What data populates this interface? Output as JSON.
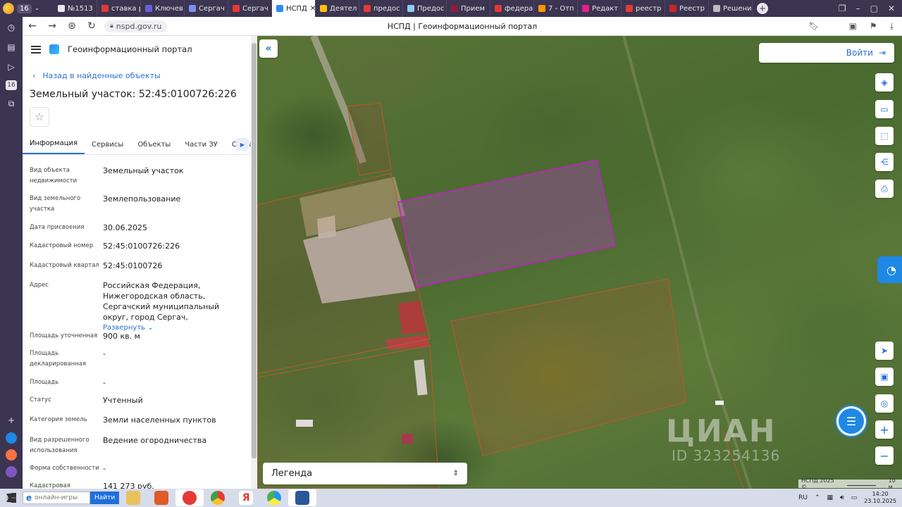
{
  "browser": {
    "tab_count": "16",
    "tabs": [
      {
        "label": "№1513",
        "color": "#e8e6ef"
      },
      {
        "label": "ставка р",
        "color": "#e53935"
      },
      {
        "label": "Ключев",
        "color": "#6d5fd3"
      },
      {
        "label": "Сергач",
        "color": "#7e8ff0"
      },
      {
        "label": "Сергач",
        "color": "#e53935"
      },
      {
        "label": "НСПД",
        "color": "#2c8cf4",
        "active": true
      },
      {
        "label": "Деятел",
        "color": "#ffc107"
      },
      {
        "label": "предос",
        "color": "#e53935"
      },
      {
        "label": "Предос",
        "color": "#90caf9"
      },
      {
        "label": "Прием",
        "color": "#8e1b3c"
      },
      {
        "label": "федера",
        "color": "#e53935"
      },
      {
        "label": "7 - Отп",
        "color": "#ff9800"
      },
      {
        "label": "Редакт",
        "color": "#e91e8c"
      },
      {
        "label": "реестр",
        "color": "#e53935"
      },
      {
        "label": "Реестр",
        "color": "#c62828"
      },
      {
        "label": "Решени",
        "color": "#bbbbbb"
      }
    ],
    "url": "nspd.gov.ru",
    "page_title": "НСПД | Геоинформационный портал"
  },
  "panel": {
    "portal_name": "Геоинформационный портал",
    "back_link": "Назад в найденные объекты",
    "title": "Земельный участок: 52:45:0100726:226",
    "tabs": [
      "Информация",
      "Сервисы",
      "Объекты",
      "Части ЗУ",
      "Состав"
    ],
    "properties": [
      {
        "label": "Вид объекта недвижимости",
        "value": "Земельный участок"
      },
      {
        "label": "Вид земельного участка",
        "value": "Землепользование"
      },
      {
        "label": "Дата присвоения",
        "value": "30.06.2025"
      },
      {
        "label": "Кадастровый номер",
        "value": "52:45:0100726:226"
      },
      {
        "label": "Кадастровый квартал",
        "value": "52:45:0100726"
      },
      {
        "label": "Адрес",
        "value": "Российская Федерация, Нижегородская область, Сергачский муниципальный округ, город Сергач,"
      },
      {
        "label": "Площадь уточненная",
        "value": "900 кв. м"
      },
      {
        "label": "Площадь декларированная",
        "value": "-"
      },
      {
        "label": "Площадь",
        "value": "-"
      },
      {
        "label": "Статус",
        "value": "Учтенный"
      },
      {
        "label": "Категория земель",
        "value": "Земли населенных пунктов"
      },
      {
        "label": "Вид разрешенного использования",
        "value": "Ведение огородничества"
      },
      {
        "label": "Форма собственности",
        "value": "-"
      },
      {
        "label": "Кадастровая стоимость",
        "value": "141 273 руб."
      }
    ],
    "expand_label": "Развернуть"
  },
  "map": {
    "login_label": "Войти",
    "legend_label": "Легенда",
    "watermark": "ЦИАН",
    "watermark_id": "ID 323254136",
    "attribution": "НСПД 2025 ©",
    "scale_label": "10 м"
  },
  "taskbar": {
    "search_placeholder": "онлайн-игры",
    "search_button": "Найти",
    "lang": "RU",
    "time": "14:20",
    "date": "23.10.2025"
  }
}
